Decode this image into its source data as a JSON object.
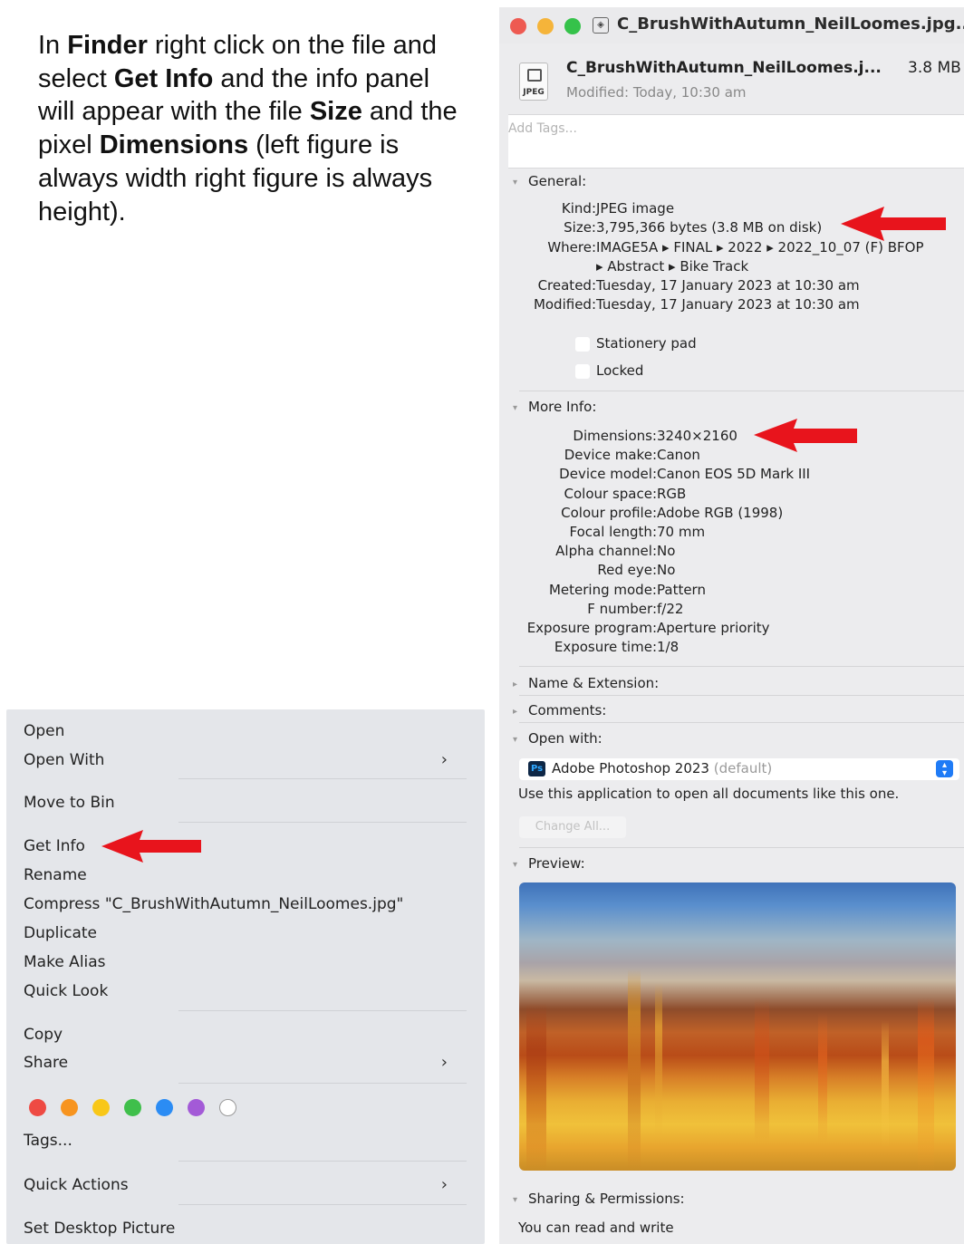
{
  "instruction": {
    "t1": "In ",
    "b1": "Finder",
    "t2": " right click on the file and select ",
    "b2": "Get Info",
    "t3": " and the info panel will appear with the file ",
    "b3": "Size",
    "t4": " and the pixel ",
    "b4": "Dimensions",
    "t5": " (left figure is always width right figure is always height)."
  },
  "context_menu": {
    "open": "Open",
    "open_with": "Open With",
    "move_to_bin": "Move to Bin",
    "get_info": "Get Info",
    "rename": "Rename",
    "compress": "Compress \"C_BrushWithAutumn_NeilLoomes.jpg\"",
    "duplicate": "Duplicate",
    "make_alias": "Make Alias",
    "quick_look": "Quick Look",
    "copy": "Copy",
    "share": "Share",
    "tags": "Tags...",
    "quick_actions": "Quick Actions",
    "set_desktop_picture": "Set Desktop Picture",
    "submenu_arrow": "›",
    "tag_colors": [
      "#ee4a43",
      "#f7941f",
      "#f8c718",
      "#3fbf4b",
      "#2b8cf4",
      "#a35ad7",
      "#ffffff"
    ]
  },
  "info_window": {
    "title": "C_BrushWithAutumn_NeilLoomes.jpg...",
    "file_icon_label": "JPEG",
    "header_name": "C_BrushWithAutumn_NeilLoomes.j...",
    "header_size": "3.8 MB",
    "header_modified": "Modified: Today, 10:30 am",
    "tags_placeholder": "Add Tags...",
    "general": {
      "heading": "General:",
      "kind_label": "Kind:",
      "kind_value": "JPEG image",
      "size_label": "Size:",
      "size_value": "3,795,366 bytes (3.8 MB on disk)",
      "where_label": "Where:",
      "where_value_1": "IMAGE5A ▸ FINAL ▸ 2022 ▸ 2022_10_07 (F) BFOP",
      "where_value_2": "▸ Abstract ▸ Bike Track",
      "created_label": "Created:",
      "created_value": "Tuesday, 17 January 2023 at 10:30 am",
      "modified_label": "Modified:",
      "modified_value": "Tuesday, 17 January 2023 at 10:30 am",
      "stationery_pad": "Stationery pad",
      "locked": "Locked"
    },
    "more_info": {
      "heading": "More Info:",
      "rows": [
        {
          "label": "Dimensions:",
          "value": "3240×2160"
        },
        {
          "label": "Device make:",
          "value": "Canon"
        },
        {
          "label": "Device model:",
          "value": "Canon EOS 5D Mark III"
        },
        {
          "label": "Colour space:",
          "value": "RGB"
        },
        {
          "label": "Colour profile:",
          "value": "Adobe RGB (1998)"
        },
        {
          "label": "Focal length:",
          "value": "70 mm"
        },
        {
          "label": "Alpha channel:",
          "value": "No"
        },
        {
          "label": "Red eye:",
          "value": "No"
        },
        {
          "label": "Metering mode:",
          "value": "Pattern"
        },
        {
          "label": "F number:",
          "value": "f/22"
        },
        {
          "label": "Exposure program:",
          "value": "Aperture priority"
        },
        {
          "label": "Exposure time:",
          "value": "1/8"
        }
      ]
    },
    "name_extension": "Name & Extension:",
    "comments": "Comments:",
    "open_with": {
      "heading": "Open with:",
      "app": "Adobe Photoshop 2023",
      "default_tag": "(default)",
      "app_icon_text": "Ps",
      "use_text": "Use this application to open all documents like this one.",
      "change_all": "Change All..."
    },
    "preview_heading": "Preview:",
    "sharing": "Sharing & Permissions:",
    "sharing_text": "You can read and write"
  }
}
